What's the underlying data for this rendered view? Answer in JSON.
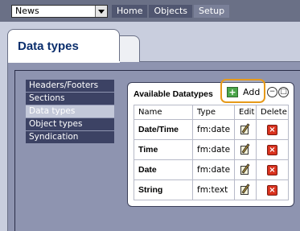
{
  "site_select": {
    "value": "News"
  },
  "top_nav": [
    {
      "label": "Home"
    },
    {
      "label": "Objects"
    },
    {
      "label": "Setup",
      "active": true
    }
  ],
  "page": {
    "title": "Data types"
  },
  "side_menu": [
    {
      "label": "Headers/Footers"
    },
    {
      "label": "Sections"
    },
    {
      "label": "Data types",
      "active": true
    },
    {
      "label": "Object types"
    },
    {
      "label": "Syndication"
    }
  ],
  "datatypes": {
    "title": "Available Datatypes",
    "add_label": "Add",
    "columns": [
      "Name",
      "Type",
      "Edit",
      "Delete"
    ],
    "rows": [
      {
        "name": "Date/Time",
        "type": "fm:date"
      },
      {
        "name": "Time",
        "type": "fm:date"
      },
      {
        "name": "Date",
        "type": "fm:date"
      },
      {
        "name": "String",
        "type": "fm:text"
      }
    ]
  },
  "colors": {
    "topbar": "#6a7086",
    "panel": "#8e94b0",
    "menu_item": "#3c4264",
    "highlight": "#e69a1a",
    "title": "#0b2f6d"
  }
}
